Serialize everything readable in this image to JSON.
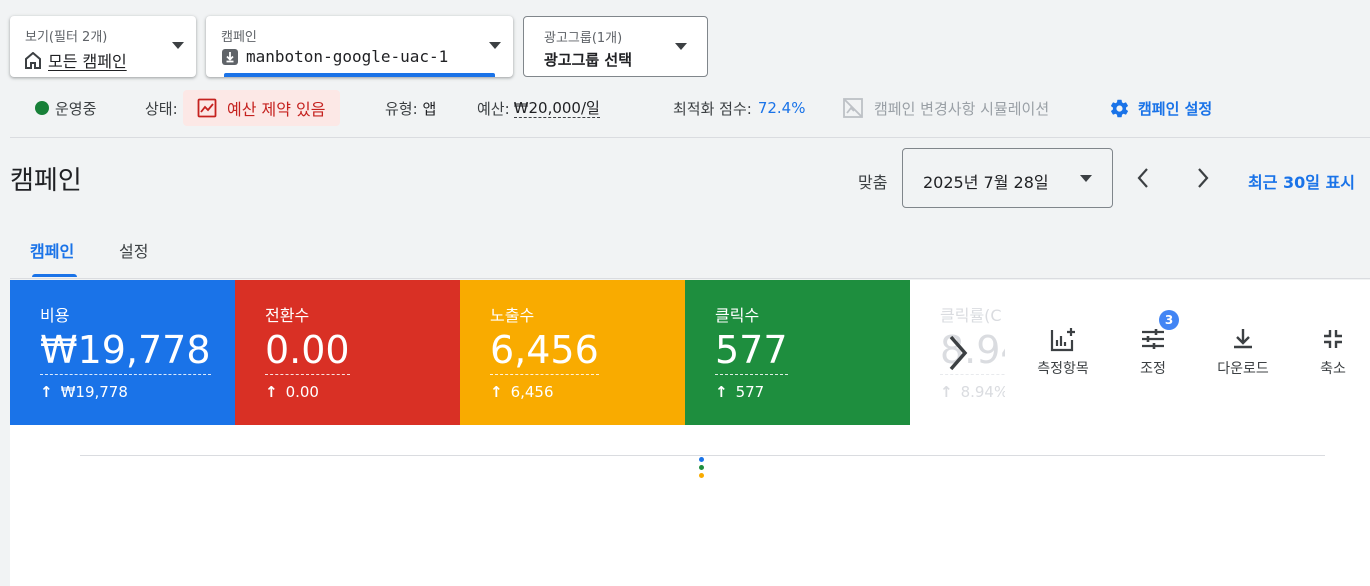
{
  "selectors": {
    "view": {
      "label": "보기(필터 2개)",
      "value": "모든 캠페인"
    },
    "campaign": {
      "label": "캠페인",
      "value": "manboton-google-uac-1"
    },
    "adgroup": {
      "label": "광고그룹(1개)",
      "value": "광고그룹 선택"
    }
  },
  "status": {
    "running": "운영중",
    "state_label": "상태:",
    "state_value": "예산 제약 있음",
    "type_label": "유형:",
    "type_value": "앱",
    "budget_label": "예산:",
    "budget_value": "₩20,000/일",
    "opt_label": "최적화 점수:",
    "opt_value": "72.4%",
    "simulate": "캠페인 변경사항 시뮬레이션",
    "settings": "캠페인 설정"
  },
  "header": {
    "title": "캠페인",
    "match_label": "맞춤",
    "date": "2025년 7월 28일",
    "recent_link": "최근 30일 표시"
  },
  "tabs": [
    {
      "label": "캠페인",
      "active": true
    },
    {
      "label": "설정",
      "active": false
    }
  ],
  "metrics": [
    {
      "label": "비용",
      "value": "₩19,778",
      "delta": "₩19,778",
      "color": "#1a73e8"
    },
    {
      "label": "전환수",
      "value": "0.00",
      "delta": "0.00",
      "color": "#d93025"
    },
    {
      "label": "노출수",
      "value": "6,456",
      "delta": "6,456",
      "color": "#f9ab00"
    },
    {
      "label": "클릭수",
      "value": "577",
      "delta": "577",
      "color": "#1e8e3e"
    },
    {
      "label": "클릭률(C",
      "value": "8.94",
      "delta": "8.94%"
    }
  ],
  "tools": {
    "metrics": "측정항목",
    "adjust": "조정",
    "adjust_badge": "3",
    "download": "다운로드",
    "collapse": "축소"
  }
}
